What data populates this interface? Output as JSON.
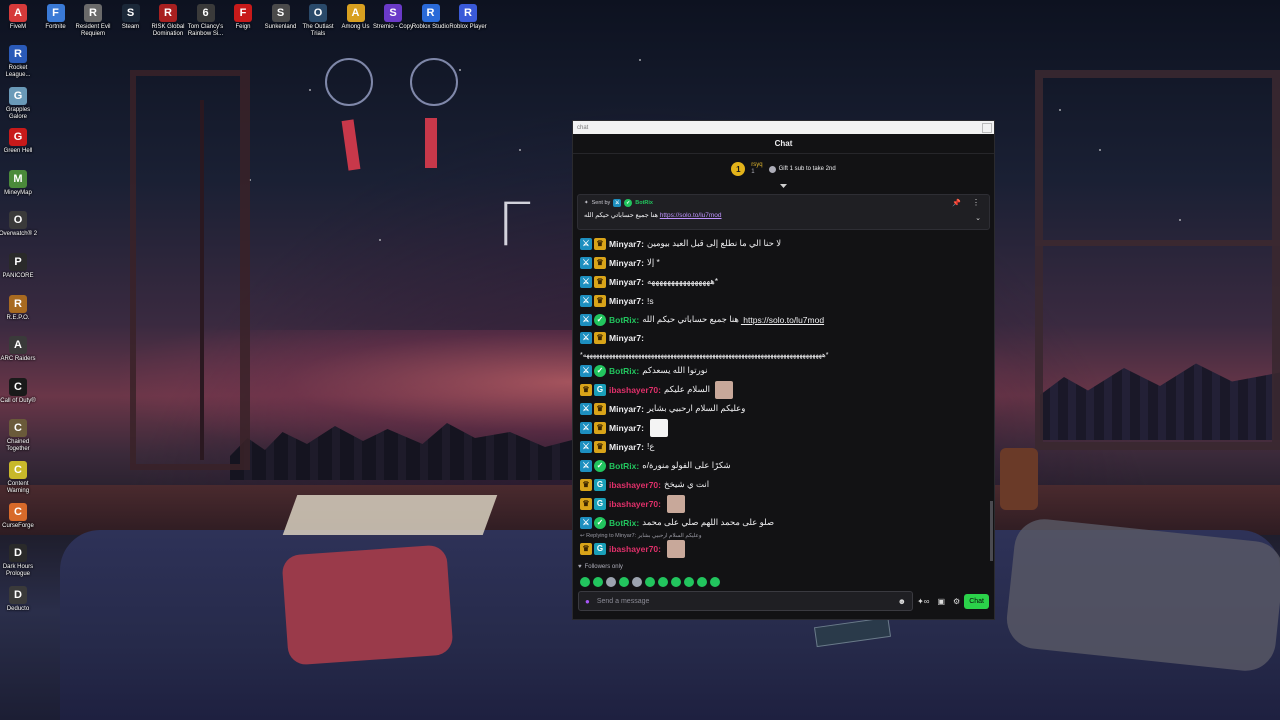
{
  "desktop": {
    "top_icons": [
      {
        "label": "FiveM",
        "icon": "fivem-icon",
        "color": "#d63a3a",
        "glyph": "A"
      },
      {
        "label": "Fortnite",
        "icon": "fortnite-icon",
        "color": "#3a7ad6",
        "glyph": "F"
      },
      {
        "label": "Resident Evil Requiem",
        "icon": "resident-evil-icon",
        "color": "#6a6a6a",
        "glyph": "R"
      },
      {
        "label": "Steam",
        "icon": "steam-icon",
        "color": "#1b2838",
        "glyph": "S"
      },
      {
        "label": "RISK Global Domination",
        "icon": "risk-icon",
        "color": "#a82020",
        "glyph": "R"
      },
      {
        "label": "Tom Clancy's Rainbow Si...",
        "icon": "rainbow-six-icon",
        "color": "#3a3a3a",
        "glyph": "6"
      },
      {
        "label": "Feign",
        "icon": "feign-icon",
        "color": "#c81a1a",
        "glyph": "F"
      },
      {
        "label": "Sunkenland",
        "icon": "sunkenland-icon",
        "color": "#4a4a4a",
        "glyph": "S"
      },
      {
        "label": "The Outlast Trials",
        "icon": "outlast-icon",
        "color": "#2a4a6a",
        "glyph": "O"
      },
      {
        "label": "Among Us",
        "icon": "among-us-icon",
        "color": "#d8a020",
        "glyph": "A"
      },
      {
        "label": "Stremio - Copy",
        "icon": "stremio-icon",
        "color": "#6a3ac8",
        "glyph": "S"
      },
      {
        "label": "Roblox Studio",
        "icon": "roblox-studio-icon",
        "color": "#2a6ad8",
        "glyph": "R"
      },
      {
        "label": "Roblox Player",
        "icon": "roblox-player-icon",
        "color": "#3a5ad8",
        "glyph": "R"
      }
    ],
    "left_icons": [
      {
        "label": "Rocket League...",
        "icon": "rocket-league-icon",
        "color": "#2a5ab8",
        "glyph": "R"
      },
      {
        "label": "Grapples Galore",
        "icon": "grapples-galore-icon",
        "color": "#6a9ab8",
        "glyph": "G"
      },
      {
        "label": "Green Hell",
        "icon": "green-hell-icon",
        "color": "#c81a1a",
        "glyph": "G"
      },
      {
        "label": "MineyMap",
        "icon": "mineymap-icon",
        "color": "#4a8a3a",
        "glyph": "M"
      },
      {
        "label": "Overwatch® 2",
        "icon": "overwatch-icon",
        "color": "#3a3a3a",
        "glyph": "O"
      },
      {
        "label": "PANICORE",
        "icon": "panicore-icon",
        "color": "#2a2a2a",
        "glyph": "P"
      },
      {
        "label": "R.E.P.O.",
        "icon": "repo-icon",
        "color": "#a86a20",
        "glyph": "R"
      },
      {
        "label": "ARC Raiders",
        "icon": "arc-raiders-icon",
        "color": "#3a3a3a",
        "glyph": "A"
      },
      {
        "label": "Call of Duty®",
        "icon": "call-of-duty-icon",
        "color": "#1a1a1a",
        "glyph": "C"
      },
      {
        "label": "Chained Together",
        "icon": "chained-together-icon",
        "color": "#6a5a3a",
        "glyph": "C"
      },
      {
        "label": "Content Warning",
        "icon": "content-warning-icon",
        "color": "#c8b82a",
        "glyph": "C"
      },
      {
        "label": "CurseForge",
        "icon": "curseforge-icon",
        "color": "#d86a2a",
        "glyph": "C"
      },
      {
        "label": "Dark Hours Prologue",
        "icon": "dark-hours-icon",
        "color": "#2a2a2a",
        "glyph": "D"
      },
      {
        "label": "Deducto",
        "icon": "deducto-icon",
        "color": "#3a3a3a",
        "glyph": "D"
      }
    ],
    "wall_text": "Γ U"
  },
  "chat": {
    "window_title": "chat",
    "header": "Chat",
    "top_sub": {
      "badge": "1",
      "user": "rsyq",
      "count": "1",
      "gift_text": "Gift 1 sub to take 2nd"
    },
    "pinned": {
      "label": "Sent by",
      "author": "BotRix",
      "text": "هنا جميع حساباتي حيكم الله",
      "link": "https://solo.to/lu7mod"
    },
    "messages": [
      {
        "badges": [
          "mod",
          "crown"
        ],
        "user": "Minyar7",
        "color": "#efeff1",
        "text": "لا حنا الي ما نطلع إلى قبل العيد بيومين"
      },
      {
        "badges": [
          "mod",
          "crown"
        ],
        "user": "Minyar7",
        "color": "#efeff1",
        "text": "إلا *"
      },
      {
        "badges": [
          "mod",
          "crown"
        ],
        "user": "Minyar7",
        "color": "#efeff1",
        "text": "ههههههههههههههههه*"
      },
      {
        "badges": [
          "mod",
          "crown"
        ],
        "user": "Minyar7",
        "color": "#efeff1",
        "text": "!s"
      },
      {
        "badges": [
          "mod",
          "verified"
        ],
        "user": "BotRix",
        "color": "#22c55e",
        "text": "هنا جميع حساباتي حيكم الله",
        "link": "https://solo.to/lu7mod"
      },
      {
        "badges": [
          "mod",
          "crown"
        ],
        "user": "Minyar7",
        "color": "#efeff1",
        "text": "",
        "tall": true,
        "wrap": "*ههههههههههههههههههههههههههههههههههههههههههههههههههههههههههههههههههههههههههه*"
      },
      {
        "badges": [
          "mod",
          "verified"
        ],
        "user": "BotRix",
        "color": "#22c55e",
        "text": "نورتوا الله يسعدكم"
      },
      {
        "badges": [
          "crown",
          "gg"
        ],
        "user": "ibashayer70",
        "color": "#e0306a",
        "text": "السلام عليكم",
        "emote": true
      },
      {
        "badges": [
          "mod",
          "crown"
        ],
        "user": "Minyar7",
        "color": "#efeff1",
        "text": "وعليكم السلام ارحبيي بشاير"
      },
      {
        "badges": [
          "mod",
          "crown"
        ],
        "user": "Minyar7",
        "color": "#efeff1",
        "text": "",
        "emote": "white"
      },
      {
        "badges": [
          "mod",
          "crown"
        ],
        "user": "Minyar7",
        "color": "#efeff1",
        "text": "!ع"
      },
      {
        "badges": [
          "mod",
          "verified"
        ],
        "user": "BotRix",
        "color": "#22c55e",
        "text": "شكرًا على الفولو منورة/ه"
      },
      {
        "badges": [
          "crown",
          "gg"
        ],
        "user": "ibashayer70",
        "color": "#e0306a",
        "text": "انت ي شيخخ"
      },
      {
        "badges": [
          "crown",
          "gg"
        ],
        "user": "ibashayer70",
        "color": "#e0306a",
        "text": "",
        "emote": true
      },
      {
        "badges": [
          "mod",
          "verified"
        ],
        "user": "BotRix",
        "color": "#22c55e",
        "text": "صلو على محمد اللهم صلي على محمد"
      },
      {
        "reply": "Replying to Minyar7: وعليكم السلام ارحبيي بشاير",
        "badges": [
          "crown",
          "gg"
        ],
        "user": "ibashayer70",
        "color": "#e0306a",
        "text": "",
        "emote": true
      }
    ],
    "followers_only": "Followers only",
    "input_placeholder": "Send a message",
    "chat_button": "Chat"
  }
}
